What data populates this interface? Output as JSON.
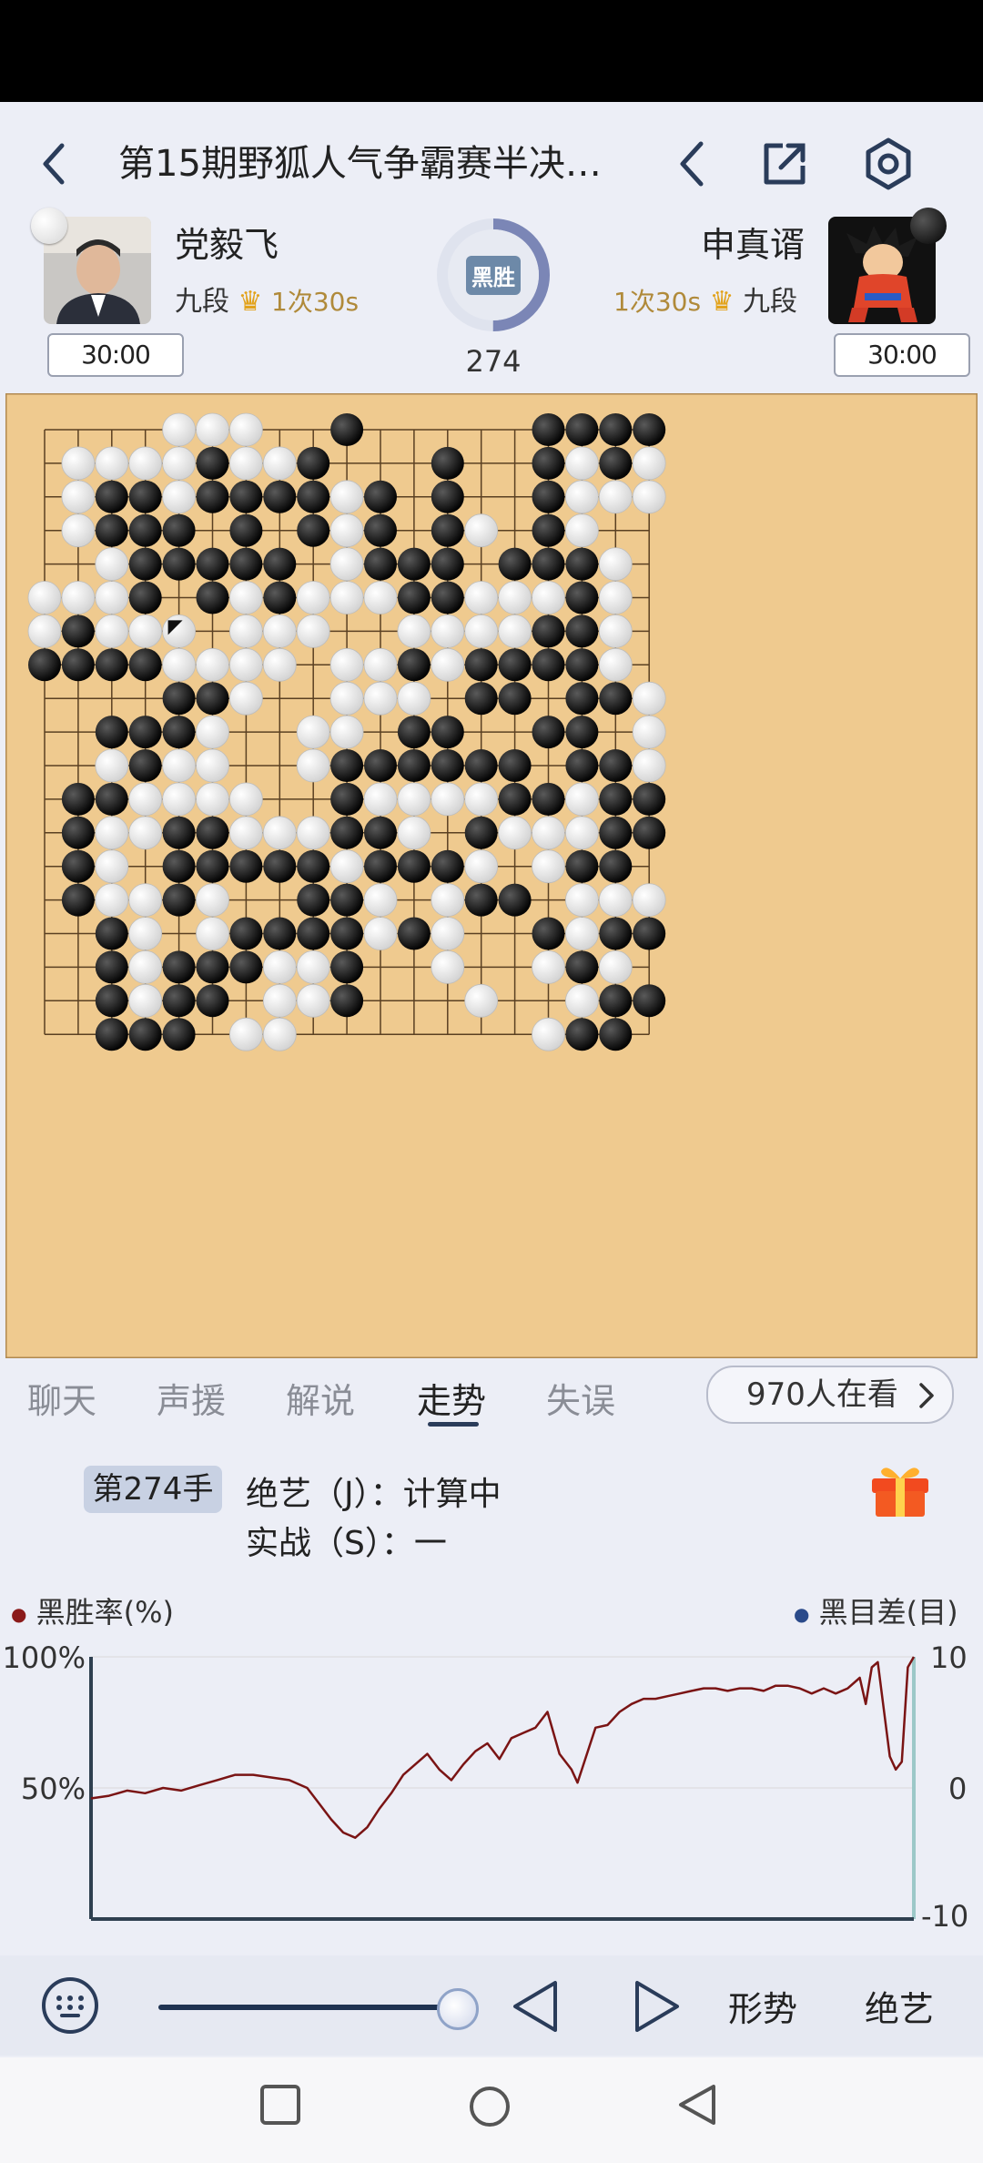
{
  "header": {
    "title": "第15期野狐人气争霸赛半决…"
  },
  "icons": {
    "back": "back-arrow-icon",
    "prev": "previous-icon",
    "share": "share-icon",
    "settings": "settings-icon"
  },
  "players": {
    "white": {
      "name": "党毅飞",
      "rank": "九段",
      "byoyomi": "1次30s",
      "clock": "30:00"
    },
    "black": {
      "name": "申真谞",
      "rank": "九段",
      "byoyomi": "1次30s",
      "clock": "30:00"
    }
  },
  "result": {
    "label": "黑胜",
    "move": "274"
  },
  "board": {
    "size": 19,
    "rows": [
      "....www..b.....bbbb",
      ".wwwwbwwb...b..bwbw",
      ".wbbwbbbbwb.b..bwww",
      ".wbbb.b.bwb.bw.bw..",
      "..wbbbbb.wbbb.bbbw.",
      "wwwb.bwbwwwbbwwwbw.",
      "wbwww.www..wwwwbbw.",
      "bbbbwwww.wwbwbbbbw.",
      "....bbw..www.bb.bbw.",
      "..bbbw..ww.bb..bb.w",
      "..wbww..wbbbbbb.bbww",
      ".bbwwww..bwwwwbbwbbw",
      ".bwwbbwwwbbw.bwwwbbb",
      ".bw.bbbbbwbbbw.wbb.",
      ".bwwbw..bbw.wbb.www",
      "..bw.wbbbbwbw..bwbb",
      "..bwbbbwwb..w..wbw.b",
      "..bwbb.wwb...w..wbb",
      "..bbb.ww.......wbb."
    ],
    "last_move": "e7"
  },
  "tabs": [
    "聊天",
    "声援",
    "解说",
    "走势",
    "失误"
  ],
  "active_tab": "走势",
  "viewers": "970人在看",
  "analysis": {
    "move_label": "第274手",
    "ai_line": "绝艺（J）：计算中",
    "game_line": "实战（S）：一"
  },
  "chart_data": {
    "type": "line",
    "legend_left": "黑胜率(%)",
    "legend_right": "黑目差(目)",
    "y_left_ticks": [
      "100%",
      "50%"
    ],
    "y_right_ticks": [
      "10",
      "0",
      "-10"
    ],
    "ylim": [
      0,
      100
    ],
    "x_range": [
      0,
      274
    ],
    "series": [
      {
        "color": "#7a1414",
        "points": [
          [
            0,
            46
          ],
          [
            6,
            47
          ],
          [
            12,
            49
          ],
          [
            18,
            48
          ],
          [
            24,
            50
          ],
          [
            30,
            49
          ],
          [
            36,
            51
          ],
          [
            42,
            53
          ],
          [
            48,
            55
          ],
          [
            54,
            55
          ],
          [
            60,
            54
          ],
          [
            66,
            53
          ],
          [
            72,
            50
          ],
          [
            76,
            44
          ],
          [
            80,
            38
          ],
          [
            84,
            33
          ],
          [
            88,
            31
          ],
          [
            92,
            35
          ],
          [
            96,
            42
          ],
          [
            100,
            48
          ],
          [
            104,
            55
          ],
          [
            108,
            59
          ],
          [
            112,
            63
          ],
          [
            116,
            57
          ],
          [
            120,
            53
          ],
          [
            124,
            59
          ],
          [
            128,
            64
          ],
          [
            132,
            67
          ],
          [
            136,
            61
          ],
          [
            140,
            69
          ],
          [
            144,
            71
          ],
          [
            148,
            73
          ],
          [
            152,
            79
          ],
          [
            156,
            63
          ],
          [
            160,
            57
          ],
          [
            162,
            52
          ],
          [
            164,
            59
          ],
          [
            168,
            73
          ],
          [
            172,
            74
          ],
          [
            176,
            79
          ],
          [
            180,
            82
          ],
          [
            184,
            84
          ],
          [
            188,
            84
          ],
          [
            192,
            85
          ],
          [
            196,
            86
          ],
          [
            200,
            87
          ],
          [
            204,
            88
          ],
          [
            208,
            88
          ],
          [
            212,
            87
          ],
          [
            216,
            88
          ],
          [
            220,
            88
          ],
          [
            224,
            87
          ],
          [
            228,
            89
          ],
          [
            232,
            89
          ],
          [
            236,
            88
          ],
          [
            240,
            86
          ],
          [
            244,
            88
          ],
          [
            248,
            86
          ],
          [
            252,
            88
          ],
          [
            256,
            92
          ],
          [
            258,
            82
          ],
          [
            260,
            96
          ],
          [
            262,
            98
          ],
          [
            264,
            80
          ],
          [
            266,
            62
          ],
          [
            268,
            57
          ],
          [
            270,
            60
          ],
          [
            272,
            96
          ],
          [
            274,
            100
          ]
        ]
      }
    ]
  },
  "bottom": {
    "keyboard_icon": "keyboard-icon",
    "shape_label": "形势",
    "ai_label": "绝艺",
    "slider_value": 1.0
  },
  "nav": {
    "square": "recent-apps-icon",
    "circle": "home-icon",
    "triangle": "back-nav-icon"
  }
}
